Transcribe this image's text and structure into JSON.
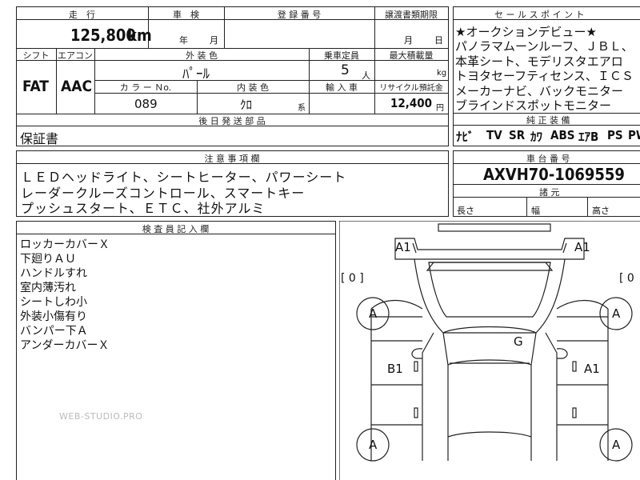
{
  "top": {
    "mileage_label": "走　行",
    "mileage_value": "125,800",
    "mileage_unit": "km",
    "inspection_label": "車　検",
    "inspection_year": "年",
    "inspection_month": "月",
    "registration_label": "登 録 番 号",
    "transfer_label": "譲渡書類期限",
    "transfer_month": "月",
    "transfer_day": "日",
    "shift_label": "シフト",
    "ac_label": "エアコン",
    "shift_value": "FAT",
    "ac_value": "AAC",
    "exterior_label": "外 装 色",
    "exterior_value": "ﾊﾟｰﾙ",
    "capacity_label": "乗車定員",
    "capacity_value": "5",
    "capacity_unit": "人",
    "load_label": "最大積載量",
    "load_unit": "kg",
    "color_no_label": "カ ラ ー Ｎo.",
    "color_no_value": "089",
    "interior_label": "内 装 色",
    "interior_value": "ｸﾛ",
    "interior_unit": "系",
    "import_label": "輸 入 車",
    "recycle_label": "リサイクル預託金",
    "recycle_value": "12,400",
    "recycle_unit": "円",
    "later_parts_label": "後 日 発 送 部 品",
    "warranty": "保証書"
  },
  "sales": {
    "title": "セ ー ル ス ポ イ ン ト",
    "lines": [
      "★オークションデビュー★",
      "パノラマムーンルーフ、ＪＢＬ、",
      "本革シート、モデリスタエアロ",
      "トヨタセーフティセンス、ＩＣＳ",
      "メーカーナビ、バックモニター",
      "ブラインドスポットモニター"
    ],
    "equipment_title": "純 正 装 備",
    "equipment": [
      "ﾅﾋﾞ",
      "TV",
      "SR",
      "ｶﾜ",
      "ABS",
      "ｴｱB",
      "PS",
      "PW"
    ]
  },
  "notes": {
    "title": "注 意 事 項 欄",
    "lines": [
      "ＬＥＤヘッドライト、シートヒーター、パワーシート",
      "レーダークルーズコントロール、スマートキー",
      "プッシュスタート、ＥＴＣ、社外アルミ"
    ]
  },
  "chassis": {
    "title": "車 台 番 号",
    "value": "AXVH70-1069559",
    "dims_title": "諸 元",
    "length": "長さ",
    "width": "幅",
    "height": "高さ"
  },
  "inspector": {
    "title": "検 査 員 記 入 欄",
    "lines": [
      "ロッカーカバーＸ",
      "下廻りＡＵ",
      "ハンドルすれ",
      "室内薄汚れ",
      "シートしわ小",
      "外装小傷有り",
      "バンパー下Ａ",
      "アンダーカバーＸ"
    ]
  },
  "diagram": {
    "a1_front_left": "A1",
    "a1_front_right": "A1",
    "g_mark": "G",
    "b1_left": "B1",
    "a1_right_side": "A1",
    "wheel_a": "A",
    "bracket_left": "[ 0 ]",
    "bracket_right": "[ 0",
    "zero": "0"
  },
  "watermark": "WEB-STUDIO.PRO"
}
